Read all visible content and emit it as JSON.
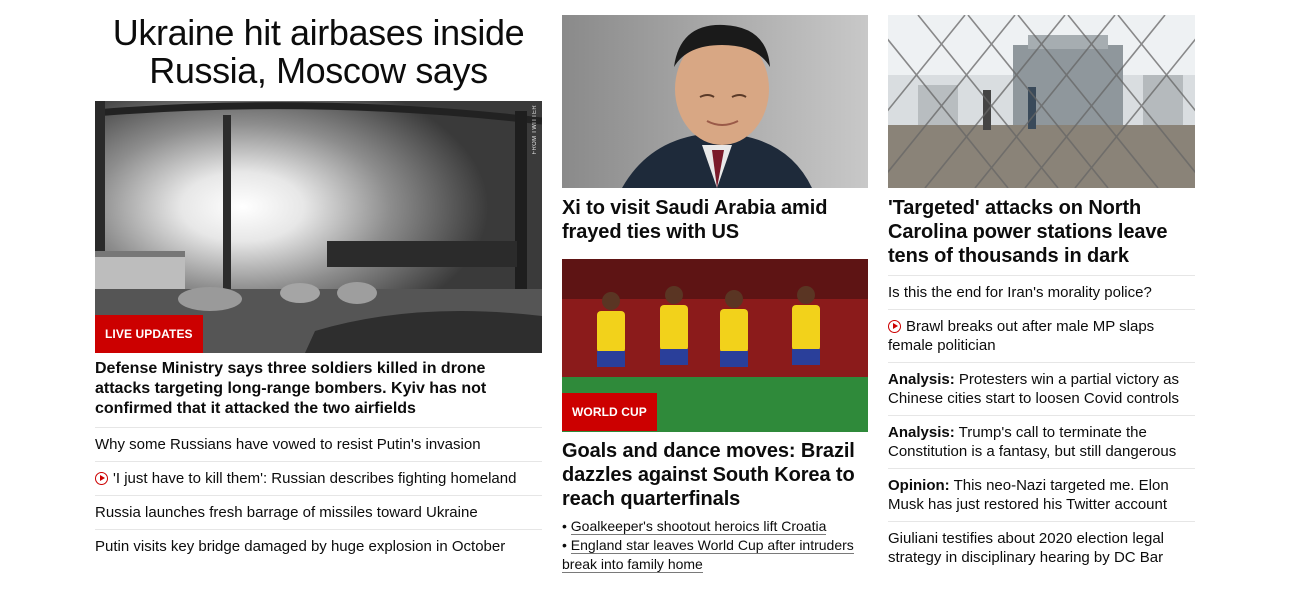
{
  "lead": {
    "title": "Ukraine hit airbases inside Russia, Moscow says",
    "image_credit": "FROM TWITTER",
    "badge": "LIVE UPDATES",
    "description": "Defense Ministry says three soldiers killed in drone attacks targeting long-range bombers. Kyiv has not confirmed that it attacked the two airfields",
    "related": [
      {
        "text": "Why some Russians have vowed to resist Putin's invasion",
        "video": false
      },
      {
        "text": "'I just have to kill them': Russian describes fighting homeland",
        "video": true
      },
      {
        "text": "Russia launches fresh barrage of missiles toward Ukraine",
        "video": false
      },
      {
        "text": "Putin visits key bridge damaged by huge explosion in October",
        "video": false
      }
    ]
  },
  "middle": {
    "story1": {
      "headline": "Xi to visit Saudi Arabia amid frayed ties with US"
    },
    "story2": {
      "badge": "WORLD CUP",
      "headline": "Goals and dance moves: Brazil dazzles against South Korea to reach quarterfinals",
      "bullets": [
        "Goalkeeper's shootout heroics lift Croatia",
        "England star leaves World Cup after intruders break into family home"
      ]
    }
  },
  "right": {
    "headline": "'Targeted' attacks on North Carolina power stations leave tens of thousands in dark",
    "items": [
      {
        "prefix": "",
        "text": "Is this the end for Iran's morality police?",
        "video": false
      },
      {
        "prefix": "",
        "text": "Brawl breaks out after male MP slaps female politician",
        "video": true
      },
      {
        "prefix": "Analysis:",
        "text": "Protesters win a partial victory as Chinese cities start to loosen Covid controls",
        "video": false
      },
      {
        "prefix": "Analysis:",
        "text": "Trump's call to terminate the Constitution is a fantasy, but still dangerous",
        "video": false
      },
      {
        "prefix": "Opinion:",
        "text": "This neo-Nazi targeted me. Elon Musk has just restored his Twitter account",
        "video": false
      },
      {
        "prefix": "",
        "text": "Giuliani testifies about 2020 election legal strategy in disciplinary hearing by DC Bar",
        "video": false
      }
    ]
  },
  "colors": {
    "accent": "#cc0000",
    "text": "#0c0c0c",
    "divider": "#e6e6e6"
  }
}
